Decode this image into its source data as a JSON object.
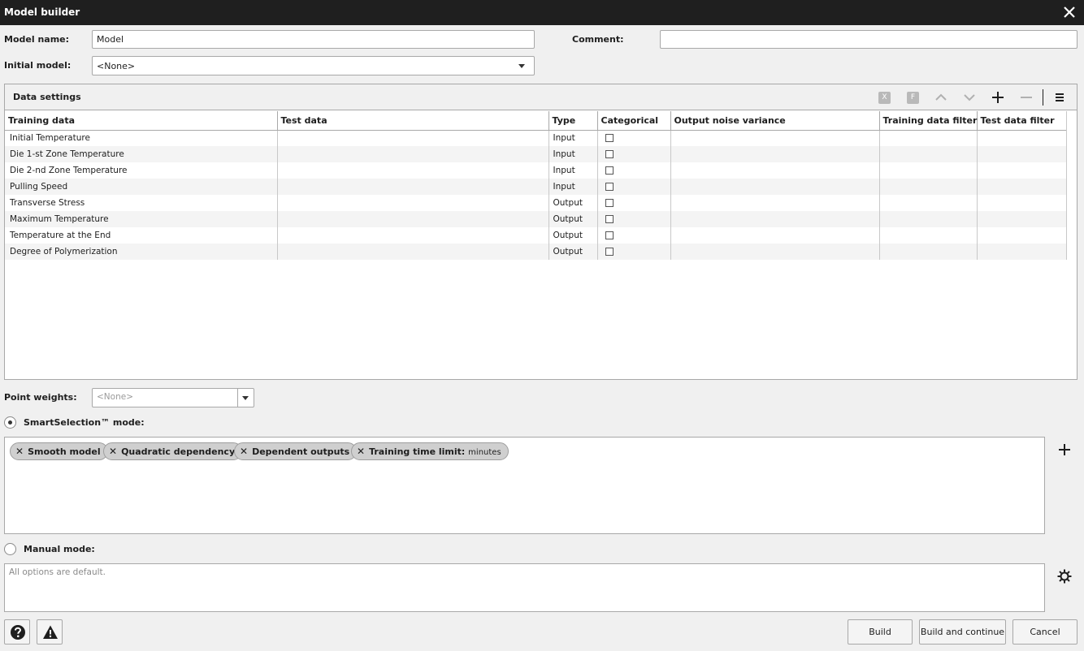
{
  "window": {
    "title": "Model builder"
  },
  "form": {
    "model_name_label": "Model name:",
    "model_name_value": "Model",
    "comment_label": "Comment:",
    "comment_value": "",
    "initial_model_label": "Initial model:",
    "initial_model_value": "<None>"
  },
  "data_settings": {
    "title": "Data settings",
    "toolbar": {
      "x_label": "X",
      "f_label": "F"
    },
    "columns": [
      "Training data",
      "Test data",
      "Type",
      "Categorical",
      "Output noise variance",
      "Training data filter",
      "Test data filter"
    ],
    "rows": [
      {
        "training": "Initial Temperature",
        "type": "Input",
        "categorical": false
      },
      {
        "training": "Die 1-st Zone Temperature",
        "type": "Input",
        "categorical": false
      },
      {
        "training": "Die 2-nd Zone Temperature",
        "type": "Input",
        "categorical": false
      },
      {
        "training": "Pulling Speed",
        "type": "Input",
        "categorical": false
      },
      {
        "training": "Transverse Stress",
        "type": "Output",
        "categorical": false
      },
      {
        "training": "Maximum Temperature",
        "type": "Output",
        "categorical": false
      },
      {
        "training": "Temperature at the End",
        "type": "Output",
        "categorical": false
      },
      {
        "training": "Degree of Polymerization",
        "type": "Output",
        "categorical": false
      }
    ]
  },
  "point_weights": {
    "label": "Point weights:",
    "placeholder": "<None>"
  },
  "smart_mode": {
    "label": "SmartSelection™ mode:",
    "selected": true,
    "tags": [
      {
        "label": "Smooth model",
        "suffix": ""
      },
      {
        "label": "Quadratic dependency",
        "suffix": ""
      },
      {
        "label": "Dependent outputs",
        "suffix": ""
      },
      {
        "label": "Training time limit:",
        "suffix": "minutes"
      }
    ]
  },
  "manual_mode": {
    "label": "Manual mode:",
    "selected": false,
    "options_text": "All options are default."
  },
  "footer": {
    "build_label": "Build",
    "build_continue_label": "Build and continue",
    "cancel_label": "Cancel"
  }
}
